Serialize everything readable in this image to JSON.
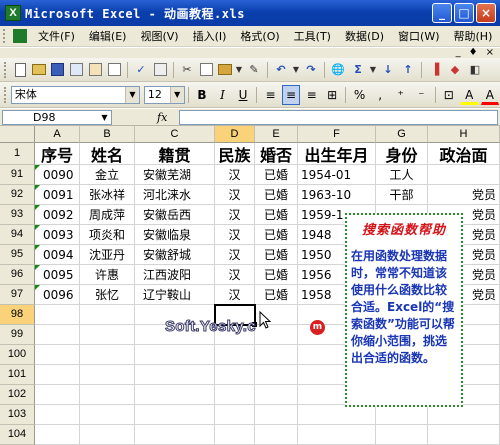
{
  "window": {
    "title": "Microsoft Excel - 动画教程.xls",
    "app_icon_letter": "X",
    "minimize": "_",
    "maximize": "□",
    "close": "×"
  },
  "menu": {
    "items": [
      "文件(F)",
      "编辑(E)",
      "视图(V)",
      "插入(I)",
      "格式(O)",
      "工具(T)",
      "数据(D)",
      "窗口(W)",
      "帮助(H)"
    ],
    "doc_controls": [
      "_",
      "♦",
      "×"
    ]
  },
  "format_toolbar": {
    "font": "宋体",
    "size": "12",
    "bold": "B",
    "italic": "I",
    "underline": "U",
    "percent": "%",
    "comma": ",",
    "font_color_letter": "A",
    "fill_letter": "A"
  },
  "formula_bar": {
    "name_box": "D98",
    "fx": "fx",
    "value": ""
  },
  "columns": [
    "A",
    "B",
    "C",
    "D",
    "E",
    "F",
    "G",
    "H"
  ],
  "selected_column": "D",
  "rows": [
    {
      "num": "1",
      "cells": [
        "序号",
        "姓名",
        "籍贯",
        "民族",
        "婚否",
        "出生年月",
        "身份",
        "政治面"
      ]
    },
    {
      "num": "91",
      "cells": [
        "0090",
        "金立",
        "安徽芜湖",
        "汉",
        "已婚",
        "1954-01",
        "工人",
        ""
      ]
    },
    {
      "num": "92",
      "cells": [
        "0091",
        "张冰祥",
        "河北涞水",
        "汉",
        "已婚",
        "1963-10",
        "干部",
        "党员"
      ]
    },
    {
      "num": "93",
      "cells": [
        "0092",
        "周成萍",
        "安徽岳西",
        "汉",
        "已婚",
        "1959-1",
        "",
        "党员"
      ]
    },
    {
      "num": "94",
      "cells": [
        "0093",
        "项炎和",
        "安徽临泉",
        "汉",
        "已婚",
        "1948",
        "",
        "党员"
      ]
    },
    {
      "num": "95",
      "cells": [
        "0094",
        "沈亚丹",
        "安徽舒城",
        "汉",
        "已婚",
        "1950",
        "",
        "党员"
      ]
    },
    {
      "num": "96",
      "cells": [
        "0095",
        "许惠",
        "江西波阳",
        "汉",
        "已婚",
        "1956",
        "",
        "党员"
      ]
    },
    {
      "num": "97",
      "cells": [
        "0096",
        "张忆",
        "辽宁鞍山",
        "汉",
        "已婚",
        "1958",
        "",
        "党员"
      ]
    },
    {
      "num": "98",
      "cells": [
        "",
        "",
        "",
        "",
        "",
        "",
        "",
        ""
      ]
    },
    {
      "num": "99",
      "cells": [
        "",
        "",
        "",
        "",
        "",
        "",
        "",
        ""
      ]
    },
    {
      "num": "100",
      "cells": [
        "",
        "",
        "",
        "",
        "",
        "",
        "",
        ""
      ]
    },
    {
      "num": "101",
      "cells": [
        "",
        "",
        "",
        "",
        "",
        "",
        "",
        ""
      ]
    },
    {
      "num": "102",
      "cells": [
        "",
        "",
        "",
        "",
        "",
        "",
        "",
        ""
      ]
    },
    {
      "num": "103",
      "cells": [
        "",
        "",
        "",
        "",
        "",
        "",
        "",
        ""
      ]
    },
    {
      "num": "104",
      "cells": [
        "",
        "",
        "",
        "",
        "",
        "",
        "",
        ""
      ]
    }
  ],
  "selected_row": "98",
  "help_box": {
    "title": "搜索函数帮助",
    "body": "在用函数处理数据时，常常不知道该使用什么函数比较合适。Excel的“搜索函数”功能可以帮你缩小范围，挑选出合适的函数。"
  },
  "watermark": "Soft.Yesky.c",
  "watermark_logo": "m"
}
